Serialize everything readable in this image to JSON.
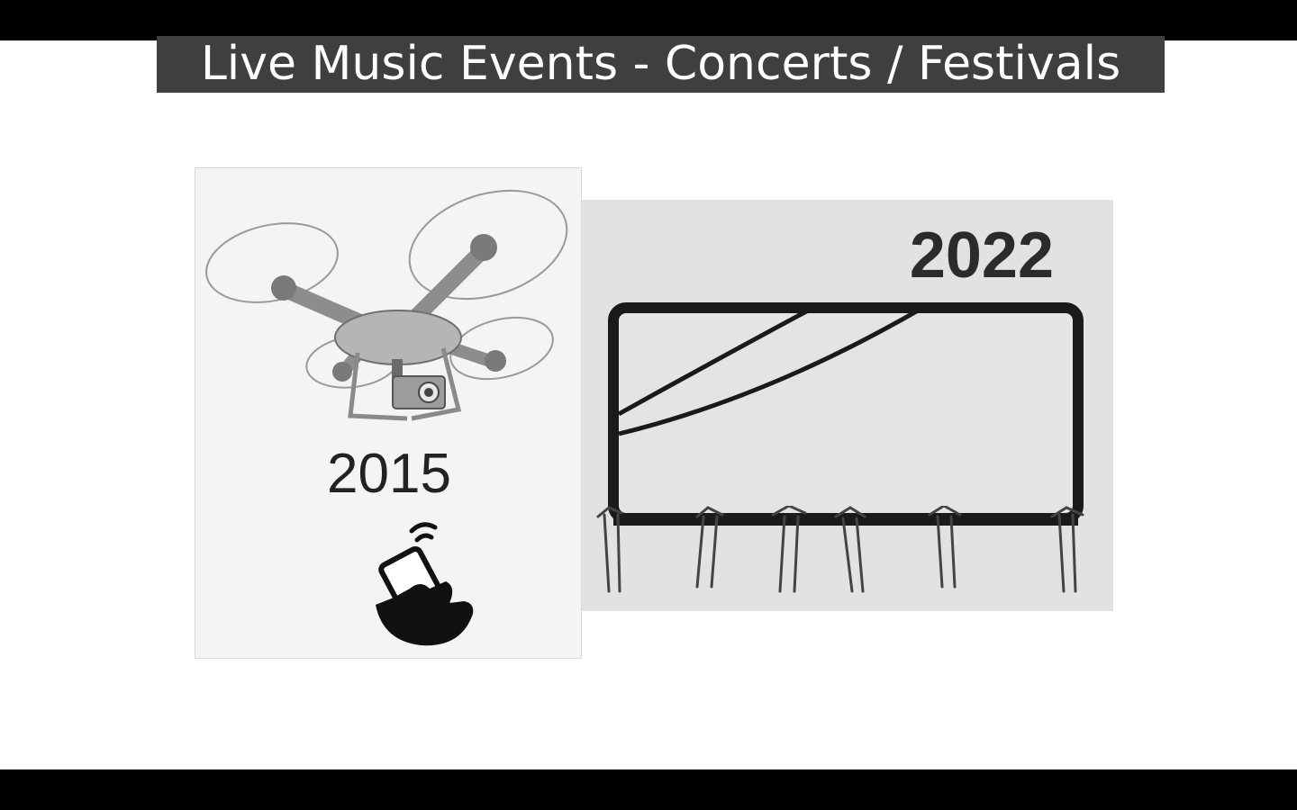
{
  "slide": {
    "title": "Live Music Events - Concerts / Festivals"
  },
  "left_panel": {
    "year": "2015",
    "icons": [
      "drone-icon",
      "camera-icon",
      "phone-in-hand-icon"
    ]
  },
  "right_panel": {
    "year": "2022",
    "icons": [
      "big-screen-icon",
      "raised-hands-icon"
    ]
  },
  "colors": {
    "letterbox": "#000000",
    "title_background": "#3f3f3f",
    "title_text": "#ffffff",
    "panel_left_bg": "#f4f4f4",
    "panel_right_bg": "#e2e2e2"
  }
}
